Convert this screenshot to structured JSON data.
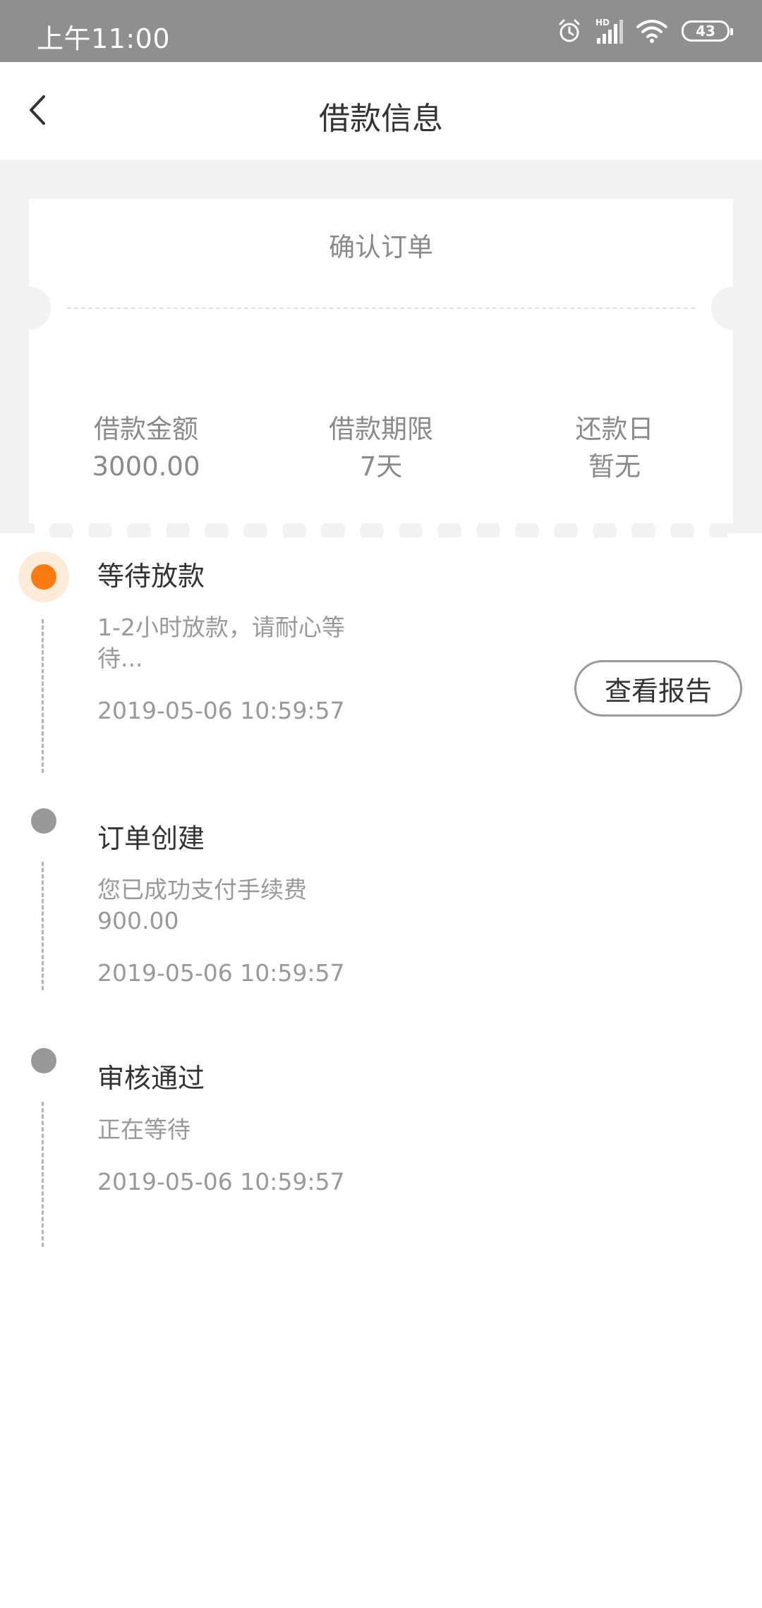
{
  "status_bar": {
    "time": "上午11:00",
    "icons": [
      "alarm-icon",
      "hd-signal-icon",
      "wifi-icon",
      "battery-icon"
    ],
    "hd_label": "HD",
    "battery": "43"
  },
  "header": {
    "title": "借款信息",
    "back_icon": "chevron-left-icon"
  },
  "ticket": {
    "title": "确认订单",
    "columns": [
      {
        "label": "借款金额",
        "value": "3000.00"
      },
      {
        "label": "借款期限",
        "value": "7天"
      },
      {
        "label": "还款日",
        "value": "暂无"
      }
    ]
  },
  "timeline": [
    {
      "title": "等待放款",
      "desc": "1-2小时放款，请耐心等待...",
      "time": "2019-05-06 10:59:57",
      "active": true,
      "button": "查看报告"
    },
    {
      "title": "订单创建",
      "desc": "您已成功支付手续费900.00",
      "time": "2019-05-06 10:59:57",
      "active": false
    },
    {
      "title": "审核通过",
      "desc": "正在等待",
      "time": "2019-05-06 10:59:57",
      "active": false
    }
  ],
  "colors": {
    "accent": "#f97a10",
    "accent_halo": "#fdebd8",
    "inactive_dot": "#999999",
    "background_gray": "#f2f2f2",
    "status_bar": "#8f8f8f"
  }
}
